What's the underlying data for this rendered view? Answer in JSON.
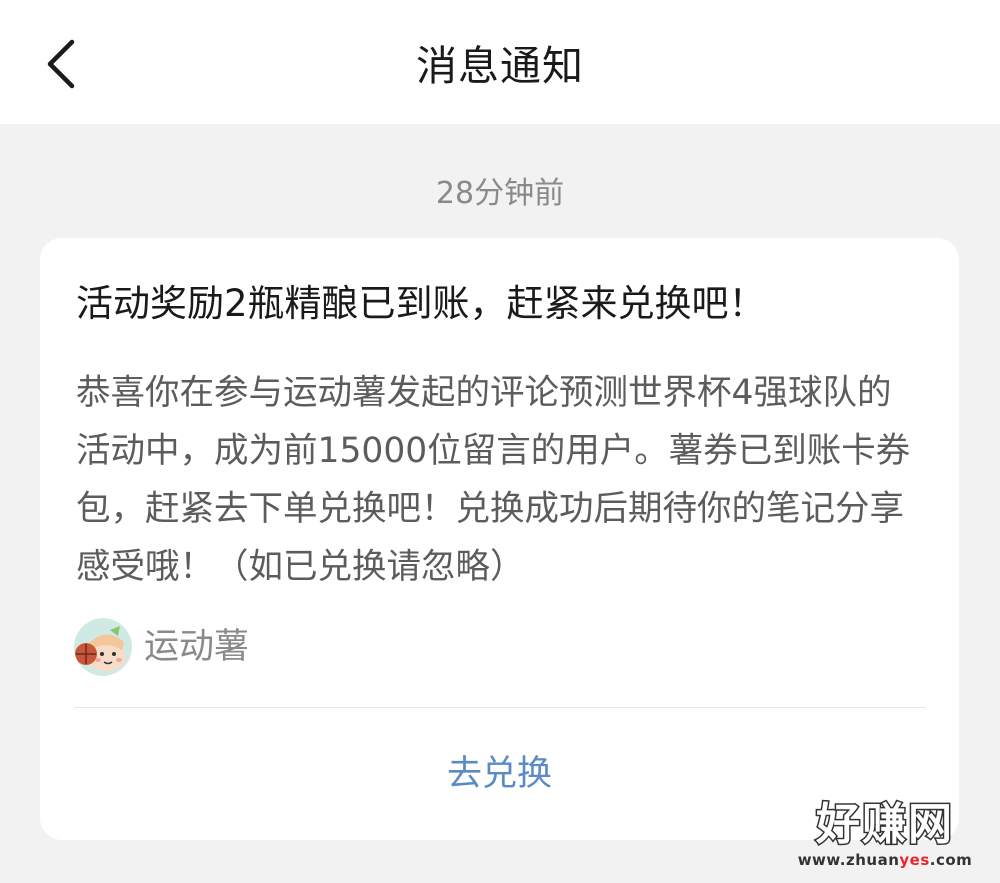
{
  "header": {
    "title": "消息通知",
    "back_icon": "chevron-left-icon"
  },
  "message": {
    "timestamp": "28分钟前",
    "title": "活动奖励2瓶精酿已到账，赶紧来兑换吧！",
    "body": "恭喜你在参与运动薯发起的评论预测世界杯4强球队的活动中，成为前15000位留言的用户。薯券已到账卡券包，赶紧去下单兑换吧！兑换成功后期待你的笔记分享感受哦！（如已兑换请忽略）",
    "sender": {
      "name": "运动薯",
      "avatar_icon": "avatar-icon"
    },
    "action_label": "去兑换"
  },
  "watermark": {
    "main": "好赚网",
    "sub_prefix": "www.zhuan",
    "sub_highlight": "yes",
    "sub_suffix": ".com"
  },
  "colors": {
    "page_bg": "#f2f2f2",
    "card_bg": "#ffffff",
    "title_text": "#1a1a1a",
    "body_text": "#5c5c5c",
    "muted_text": "#8a8a8a",
    "link": "#5b8ac4"
  }
}
